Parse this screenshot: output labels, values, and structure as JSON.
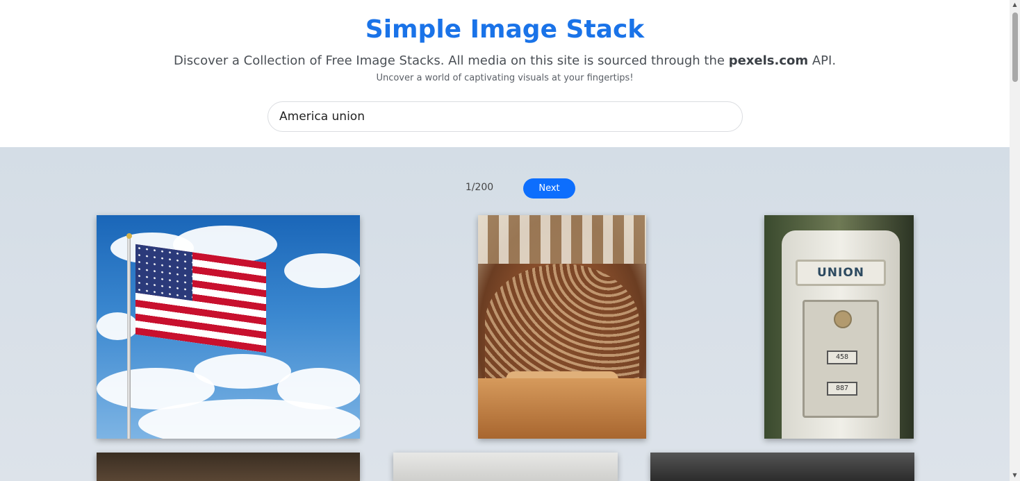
{
  "header": {
    "title": "Simple Image Stack",
    "subtitle_prefix": "Discover a Collection of Free Image Stacks. All media on this site is sourced through the ",
    "subtitle_brand": "pexels.com",
    "subtitle_suffix": " API.",
    "tagline": "Uncover a world of captivating visuals at your fingertips!"
  },
  "search": {
    "value": "America union"
  },
  "pagination": {
    "count": "1/200",
    "next_label": "Next"
  },
  "colors": {
    "accent": "#1a73e8",
    "button": "#0d6efd"
  },
  "photos": [
    {
      "subject": "american-flag"
    },
    {
      "subject": "parliament-chamber"
    },
    {
      "subject": "union-gas-pump",
      "label": "UNION",
      "meter_top": "458",
      "meter_bottom": "887"
    },
    {
      "subject": "dark-interior"
    },
    {
      "subject": "light-scene"
    },
    {
      "subject": "monochrome-scene"
    }
  ]
}
